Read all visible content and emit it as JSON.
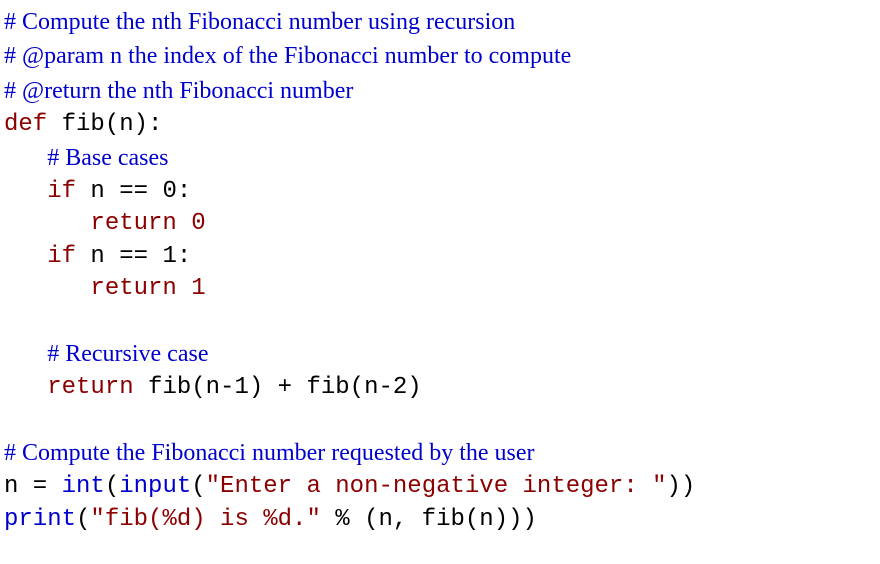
{
  "lines": {
    "c1": "# Compute the nth Fibonacci number using recursion",
    "c2": "# @param n the index of the Fibonacci number to compute",
    "c3": "# @return the nth Fibonacci number",
    "kw_def": "def",
    "fib_decl": " fib(n):",
    "c4": "# Base cases",
    "kw_if1": "if",
    "if1_rest": " n == 0:",
    "kw_ret1": "return",
    "ret1_sp": " ",
    "num0": "0",
    "kw_if2": "if",
    "if2_rest": " n == 1:",
    "kw_ret2": "return",
    "ret2_sp": " ",
    "num1": "1",
    "c5": "# Recursive case",
    "kw_ret3": "return",
    "ret3_rest": " fib(n-1) + fib(n-2)",
    "c6": "# Compute the Fibonacci number requested by the user",
    "assign_lhs": "n = ",
    "fn_int": "int",
    "paren_open1": "(",
    "fn_input": "input",
    "paren_open2": "(",
    "str1": "\"Enter a non-negative integer: \"",
    "paren_close12": "))",
    "fn_print": "print",
    "paren_open3": "(",
    "str2": "\"fib(%d) is %d.\"",
    "print_rest": " % (n, fib(n)))"
  }
}
